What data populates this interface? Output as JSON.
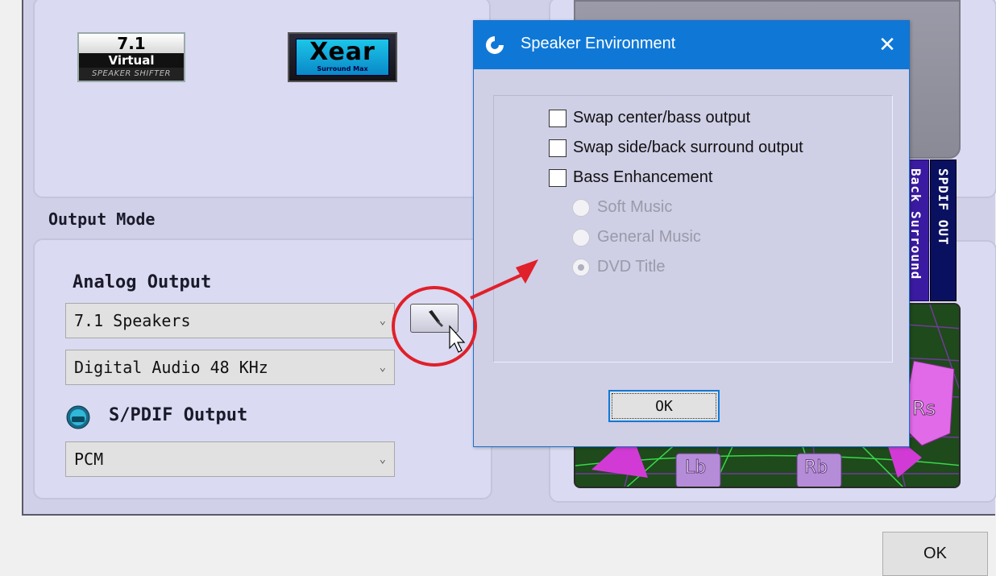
{
  "window": {
    "ok_label": "OK"
  },
  "badges": {
    "virtual_71": {
      "line1": "7.1",
      "line2": "Virtual",
      "line3": "SPEAKER SHIFTER"
    },
    "xear": {
      "logo": "Xear",
      "sub": "Surround Max"
    }
  },
  "output_mode": {
    "title": "Output Mode",
    "analog_label": "Analog Output",
    "speakers_value": "7.1 Speakers",
    "sample_rate_value": "Digital Audio 48 KHz",
    "spdif_label": "S/PDIF Output",
    "spdif_value": "PCM"
  },
  "preview": {
    "tabs": [
      "Back Surround",
      "SPDIF OUT"
    ],
    "speakers": [
      "Lb",
      "Rb",
      "Rs"
    ]
  },
  "dialog": {
    "title": "Speaker Environment",
    "checkboxes": [
      {
        "label": "Swap center/bass output",
        "checked": false
      },
      {
        "label": "Swap side/back surround output",
        "checked": false
      },
      {
        "label": "Bass Enhancement",
        "checked": false
      }
    ],
    "radios": [
      {
        "label": "Soft Music",
        "selected": false,
        "enabled": false
      },
      {
        "label": "General Music",
        "selected": false,
        "enabled": false
      },
      {
        "label": "DVD Title",
        "selected": true,
        "enabled": false
      }
    ],
    "ok_label": "OK"
  },
  "colors": {
    "title_bar": "#0f78d7",
    "annotation": "#e0202a",
    "panel_bg": "#d0d0e8",
    "tab_purple": "#3a1aa0",
    "tab_navy": "#0a1060"
  },
  "icons": {
    "dialog_title_icon": "audio-logo-icon",
    "close": "close-icon",
    "tool": "wrench-icon",
    "spdif": "spdif-icon",
    "cursor": "mouse-cursor-icon"
  }
}
